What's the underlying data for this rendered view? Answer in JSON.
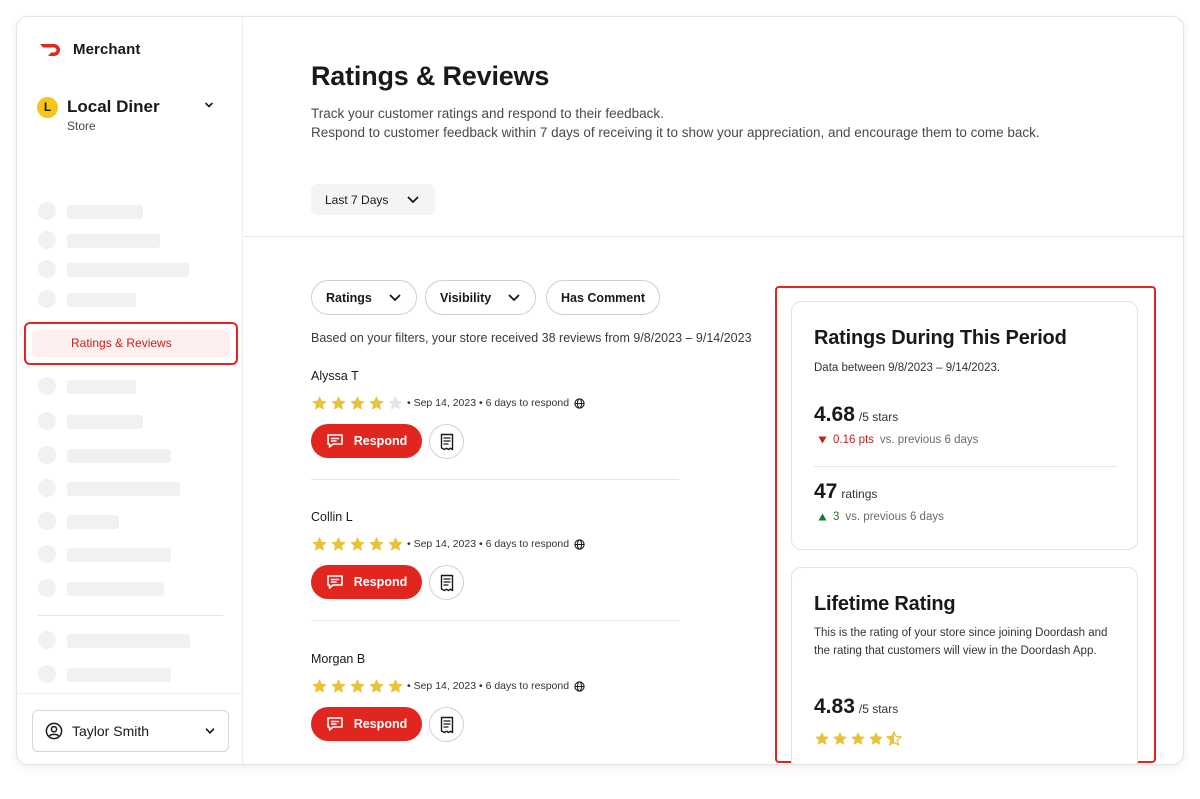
{
  "brand": {
    "name": "Merchant"
  },
  "store": {
    "initial": "L",
    "name": "Local Diner",
    "type": "Store"
  },
  "sidebar": {
    "active_item": "Ratings & Reviews"
  },
  "user": {
    "name": "Taylor Smith"
  },
  "page": {
    "title": "Ratings & Reviews",
    "desc_line1": "Track your customer ratings and respond to their feedback.",
    "desc_line2": "Respond to customer feedback within 7 days of receiving it to show your appreciation, and encourage them to come back.",
    "range": "Last 7 Days"
  },
  "filters": {
    "ratings": "Ratings",
    "visibility": "Visibility",
    "has_comment": "Has Comment",
    "note": "Based on your filters, your store received 38 reviews from 9/8/2023 – 9/14/2023"
  },
  "reviews": [
    {
      "name": "Alyssa T",
      "rating": 4,
      "meta": "• Sep 14, 2023 • 6 days to respond",
      "action": "Respond"
    },
    {
      "name": "Collin L",
      "rating": 5,
      "meta": "• Sep 14, 2023 • 6 days to respond",
      "action": "Respond"
    },
    {
      "name": "Morgan B",
      "rating": 5,
      "meta": "• Sep 14, 2023 • 6 days to respond",
      "action": "Respond"
    }
  ],
  "period": {
    "title": "Ratings During This Period",
    "sub": "Data between 9/8/2023 – 9/14/2023.",
    "rating_value": "4.68",
    "rating_unit": "/5 stars",
    "rating_delta": "0.16 pts",
    "rating_delta_text": "vs. previous 6 days",
    "count_value": "47",
    "count_unit": "ratings",
    "count_delta": "3",
    "count_delta_text": "vs. previous 6 days"
  },
  "lifetime": {
    "title": "Lifetime Rating",
    "sub": "This is the rating of your store since joining Doordash and the rating that customers will view in the Doordash App.",
    "value": "4.83",
    "unit": "/5 stars",
    "stars": 4.5
  },
  "colors": {
    "accent": "#e0261f",
    "star": "#e8c33a",
    "star_empty": "#e6e6e6",
    "positive": "#1c7a2c"
  }
}
